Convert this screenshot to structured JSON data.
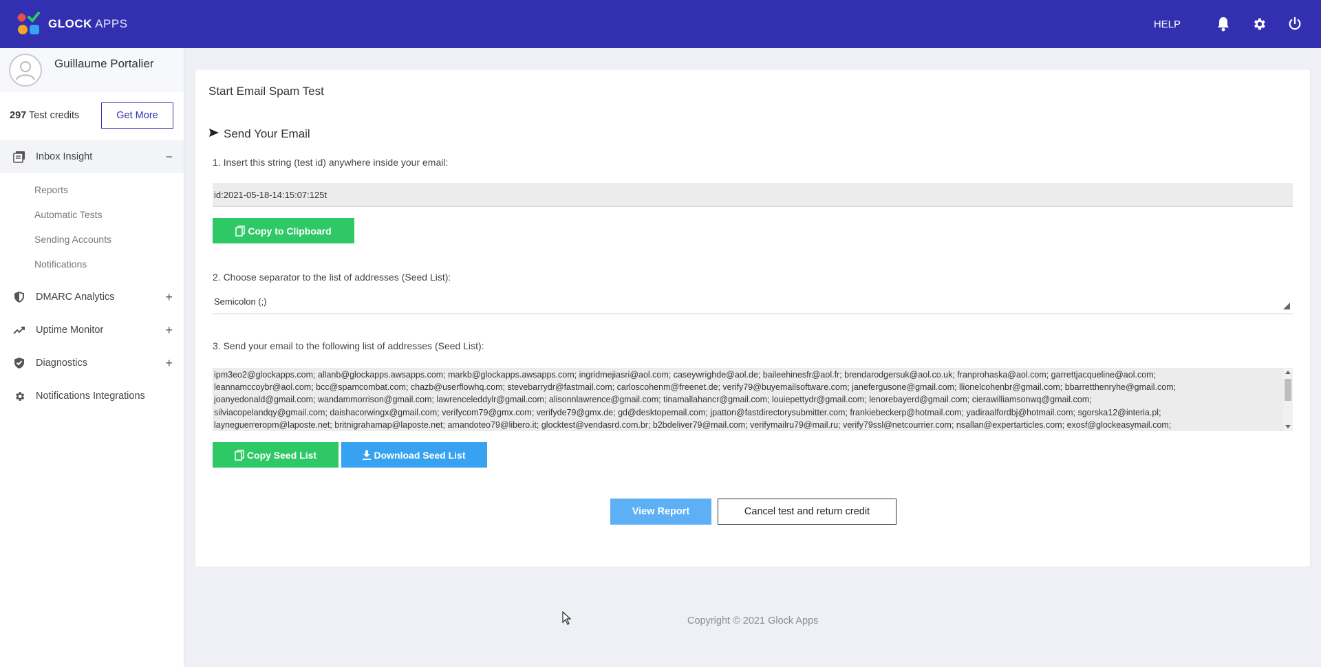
{
  "header": {
    "brand_bold": "GLOCK",
    "brand_light": " APPS",
    "help": "HELP",
    "brand_colors": [
      "#e8504c",
      "#2ec866",
      "#f5a623",
      "#36a2f0"
    ],
    "bar_color": "#3230b0",
    "icons": [
      "bell-icon",
      "gear-icon",
      "power-icon"
    ]
  },
  "sidebar": {
    "user_name": "Guillaume Portalier",
    "credits_count": "297",
    "credits_label": " Test credits",
    "get_more": "Get More",
    "sections": [
      {
        "label": "Inbox Insight",
        "toggle": "−",
        "icon": "inbox-icon"
      },
      {
        "label": "DMARC Analytics",
        "toggle": "+",
        "icon": "shield-icon"
      },
      {
        "label": "Uptime Monitor",
        "toggle": "+",
        "icon": "trending-up-icon"
      },
      {
        "label": "Diagnostics",
        "toggle": "+",
        "icon": "shield-check-icon"
      },
      {
        "label": "Notifications Integrations",
        "icon": "gear-icon"
      }
    ],
    "sub_items": [
      "Reports",
      "Automatic Tests",
      "Sending Accounts",
      "Notifications"
    ]
  },
  "main": {
    "title": "Start Email Spam Test",
    "send_title": "Send Your Email",
    "step1": "1. Insert this string (test id) anywhere inside your email:",
    "test_id": "id:2021-05-18-14:15:07:125t",
    "copy_clipboard": "Copy to Clipboard",
    "step2": "2. Choose separator to the list of addresses (Seed List):",
    "separator": "Semicolon (;)",
    "step3": "3. Send your email to the following list of addresses (Seed List):",
    "seed_lines": [
      "ipm3eo2@glockapps.com; allanb@glockapps.awsapps.com; markb@glockapps.awsapps.com; ingridmejiasri@aol.com; caseywrighde@aol.de; baileehinesfr@aol.fr; brendarodgersuk@aol.co.uk; franprohaska@aol.com; garrettjacqueline@aol.com;",
      "leannamccoybr@aol.com; bcc@spamcombat.com; chazb@userflowhq.com; stevebarrydr@fastmail.com; carloscohenm@freenet.de; verify79@buyemailsoftware.com; janefergusone@gmail.com; llionelcohenbr@gmail.com; bbarretthenryhe@gmail.com;",
      "joanyedonald@gmail.com; wandammorrison@gmail.com; lawrenceleddylr@gmail.com; alisonnlawrence@gmail.com; tinamallahancr@gmail.com; louiepettydr@gmail.com; lenorebayerd@gmail.com; cierawilliamsonwq@gmail.com;",
      "silviacopelandqy@gmail.com; daishacorwingx@gmail.com; verifycom79@gmx.com; verifyde79@gmx.de; gd@desktopemail.com; jpatton@fastdirectorysubmitter.com; frankiebeckerp@hotmail.com; yadiraalfordbj@hotmail.com; sgorska12@interia.pl;",
      "layneguerreropm@laposte.net; britnigrahamap@laposte.net; amandoteo79@libero.it; glocktest@vendasrd.com.br; b2bdeliver79@mail.com; verifymailru79@mail.ru; verify79ssl@netcourrier.com; nsallan@expertarticles.com; exosf@glockeasymail.com;"
    ],
    "copy_seed": "Copy Seed List",
    "download_seed": "Download Seed List",
    "view_report": "View Report",
    "cancel": "Cancel test and return credit"
  },
  "footer": "Copyright © 2021 Glock Apps"
}
